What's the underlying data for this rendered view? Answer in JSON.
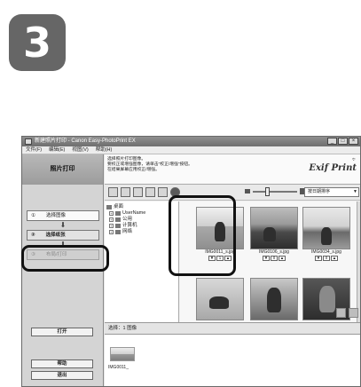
{
  "step_number": "3",
  "window": {
    "title": "新建照片打印 - Canon Easy-PhotoPrint EX",
    "controls": [
      "_",
      "□",
      "×"
    ]
  },
  "menu": [
    "文件(F)",
    "编辑(E)",
    "视图(V)",
    "帮助(H)"
  ],
  "sidebar": {
    "heading": "照片打印",
    "steps": [
      {
        "num": "①",
        "label": "选择图像"
      },
      {
        "num": "②",
        "label": "选择纸张"
      },
      {
        "num": "③",
        "label": "布局/打印"
      }
    ],
    "arrow": "⬇",
    "open_label": "打开",
    "help_label": "帮助",
    "exit_label": "退出"
  },
  "info": {
    "lines": [
      "选择照片打印图像。",
      "要校正或增强图像，请单击\"校正/增强\"按钮。",
      "在结果屏幕应用校正/增强。"
    ],
    "logo": "Exif Print"
  },
  "toolbar": {
    "icons": [
      "select-all-icon",
      "grid-icon",
      "pen-icon",
      "image-icon",
      "rotate-icon",
      "globe-icon"
    ],
    "sort_label": "按日期排序"
  },
  "tree": [
    {
      "label": "桌面",
      "level": 0,
      "expander": ""
    },
    {
      "label": "UserName",
      "level": 1,
      "expander": "+"
    },
    {
      "label": "公用",
      "level": 1,
      "expander": "+"
    },
    {
      "label": "计算机",
      "level": 1,
      "expander": "+"
    },
    {
      "label": "网络",
      "level": 1,
      "expander": "+"
    }
  ],
  "thumbnails": [
    {
      "filename": "IMG0011_s.jpg",
      "copies": "1"
    },
    {
      "filename": "IMG0106_s.jpg",
      "copies": "0"
    },
    {
      "filename": "IMG0034_s.jpg",
      "copies": "0"
    }
  ],
  "stepper": {
    "down": "▼",
    "up": "▲"
  },
  "tray": {
    "heading": "选择：1 图像",
    "item_caption": "IMG0011_"
  }
}
